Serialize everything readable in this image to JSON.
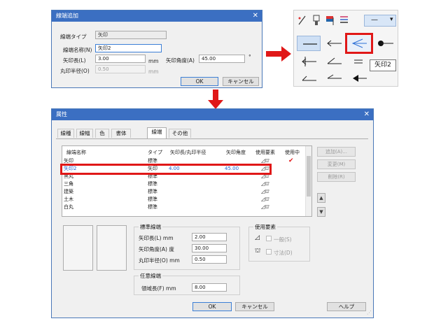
{
  "dialog1": {
    "title": "線端追加",
    "line_type_label": "線端タイプ",
    "line_type_value": "矢印",
    "name_label": "線端名称(N)",
    "name_value": "矢印2",
    "arrow_length_label": "矢印長(L)",
    "arrow_length_value": "3.00",
    "arrow_length_unit": "mm",
    "arrow_angle_label": "矢印角度(A)",
    "arrow_angle_value": "45.00",
    "arrow_angle_unit": "°",
    "circle_radius_label": "丸印半径(O)",
    "circle_radius_value": "0.50",
    "circle_radius_unit": "mm",
    "ok_label": "OK",
    "cancel_label": "キャンセル",
    "close_glyph": "✕"
  },
  "palette": {
    "tooltip": "矢印2",
    "line_dropdown": "—",
    "dropdown_arrow": "▾"
  },
  "dialog2": {
    "title": "属性",
    "close_glyph": "✕",
    "tabs": [
      "線種",
      "線幅",
      "色",
      "書体",
      "線端",
      "その他"
    ],
    "active_tab": 4,
    "columns": [
      "線端名称",
      "タイプ",
      "矢印長/丸印半径",
      "矢印角度",
      "使用要素",
      "使用中"
    ],
    "rows": [
      {
        "name": "矢印",
        "type": "標準",
        "len": "",
        "angle": "",
        "used": false,
        "selected": false
      },
      {
        "name": "矢印2",
        "type": "矢印",
        "len": "4.00",
        "angle": "45.00",
        "used": false,
        "selected": true
      },
      {
        "name": "黒丸",
        "type": "標準",
        "len": "",
        "angle": "",
        "used": false,
        "selected": false
      },
      {
        "name": "三角",
        "type": "標準",
        "len": "",
        "angle": "",
        "used": false,
        "selected": false
      },
      {
        "name": "建築",
        "type": "標準",
        "len": "",
        "angle": "",
        "used": false,
        "selected": false
      },
      {
        "name": "土木",
        "type": "標準",
        "len": "",
        "angle": "",
        "used": false,
        "selected": false
      },
      {
        "name": "白丸",
        "type": "標準",
        "len": "",
        "angle": "",
        "used": false,
        "selected": false
      }
    ],
    "in_use_mark": "✔",
    "side_buttons": {
      "add": "追加(A)...",
      "change": "変更(M)",
      "delete": "削除(R)"
    },
    "move_up": "▲",
    "move_down": "▼",
    "standard_group": {
      "title": "標準線端",
      "arrow_length_label": "矢印長(L) mm",
      "arrow_length_value": "2.00",
      "arrow_angle_label": "矢印角度(A) 度",
      "arrow_angle_value": "30.00",
      "circle_radius_label": "丸印半径(O) mm",
      "circle_radius_value": "0.50"
    },
    "optional_group": {
      "title": "任意線端",
      "label": "領域長(F) mm",
      "value": "8.00"
    },
    "usage_group": {
      "title": "使用要素",
      "general_label": "一般(S)",
      "dimension_label": "寸法(D)"
    },
    "ok_label": "OK",
    "cancel_label": "キャンセル",
    "help_label": "ヘルプ"
  },
  "colors": {
    "title_blue": "#3b6fc2",
    "highlight_red": "#e01818",
    "selection_blue": "#1f5fd1"
  }
}
